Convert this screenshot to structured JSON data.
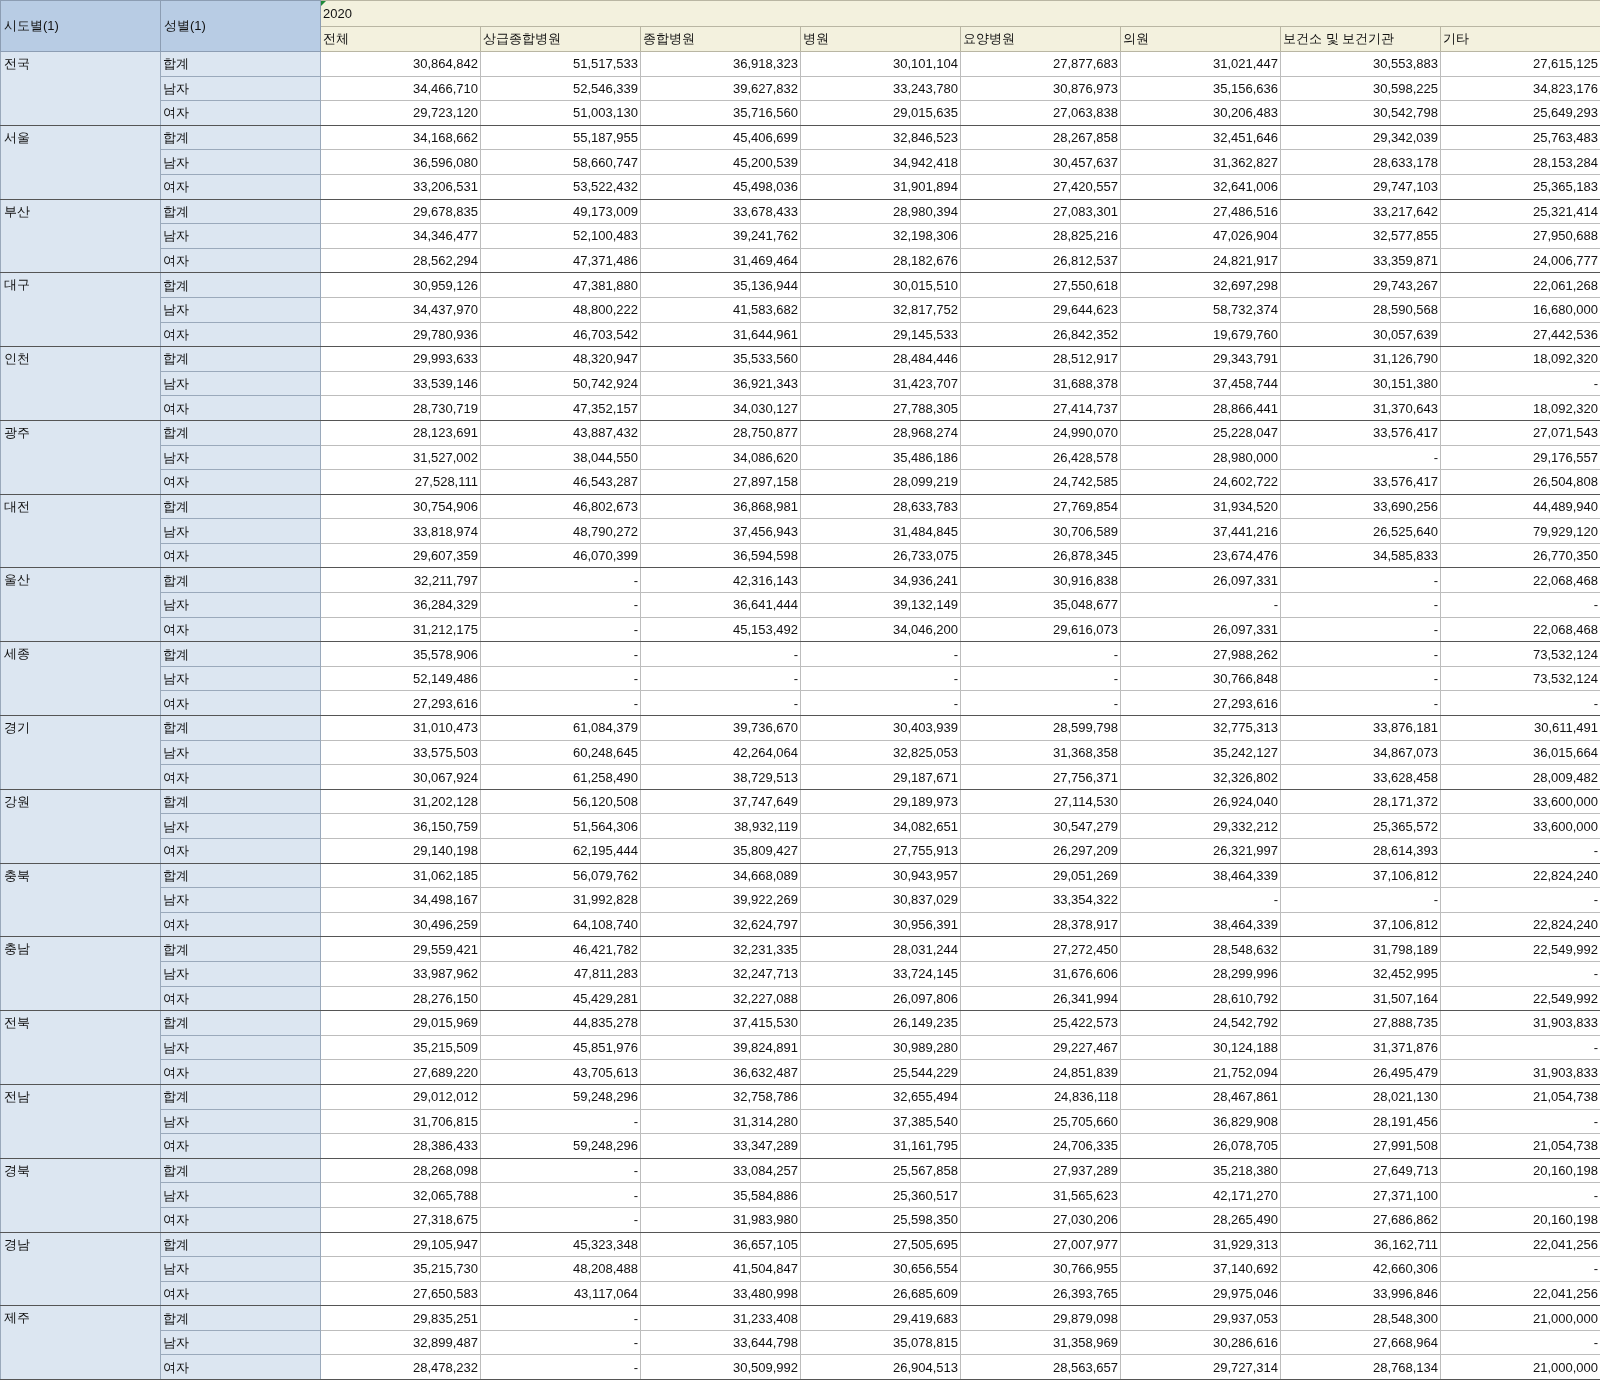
{
  "table": {
    "row_headers": [
      "시도별(1)",
      "성별(1)"
    ],
    "year": "2020",
    "columns": [
      "전체",
      "상급종합병원",
      "종합병원",
      "병원",
      "요양병원",
      "의원",
      "보건소 및 보건기관",
      "기타"
    ],
    "regions": [
      {
        "name": "전국",
        "rows": [
          {
            "sex": "합계",
            "values": [
              "30,864,842",
              "51,517,533",
              "36,918,323",
              "30,101,104",
              "27,877,683",
              "31,021,447",
              "30,553,883",
              "27,615,125"
            ]
          },
          {
            "sex": "남자",
            "values": [
              "34,466,710",
              "52,546,339",
              "39,627,832",
              "33,243,780",
              "30,876,973",
              "35,156,636",
              "30,598,225",
              "34,823,176"
            ]
          },
          {
            "sex": "여자",
            "values": [
              "29,723,120",
              "51,003,130",
              "35,716,560",
              "29,015,635",
              "27,063,838",
              "30,206,483",
              "30,542,798",
              "25,649,293"
            ]
          }
        ]
      },
      {
        "name": "서울",
        "rows": [
          {
            "sex": "합계",
            "values": [
              "34,168,662",
              "55,187,955",
              "45,406,699",
              "32,846,523",
              "28,267,858",
              "32,451,646",
              "29,342,039",
              "25,763,483"
            ]
          },
          {
            "sex": "남자",
            "values": [
              "36,596,080",
              "58,660,747",
              "45,200,539",
              "34,942,418",
              "30,457,637",
              "31,362,827",
              "28,633,178",
              "28,153,284"
            ]
          },
          {
            "sex": "여자",
            "values": [
              "33,206,531",
              "53,522,432",
              "45,498,036",
              "31,901,894",
              "27,420,557",
              "32,641,006",
              "29,747,103",
              "25,365,183"
            ]
          }
        ]
      },
      {
        "name": "부산",
        "rows": [
          {
            "sex": "합계",
            "values": [
              "29,678,835",
              "49,173,009",
              "33,678,433",
              "28,980,394",
              "27,083,301",
              "27,486,516",
              "33,217,642",
              "25,321,414"
            ]
          },
          {
            "sex": "남자",
            "values": [
              "34,346,477",
              "52,100,483",
              "39,241,762",
              "32,198,306",
              "28,825,216",
              "47,026,904",
              "32,577,855",
              "27,950,688"
            ]
          },
          {
            "sex": "여자",
            "values": [
              "28,562,294",
              "47,371,486",
              "31,469,464",
              "28,182,676",
              "26,812,537",
              "24,821,917",
              "33,359,871",
              "24,006,777"
            ]
          }
        ]
      },
      {
        "name": "대구",
        "rows": [
          {
            "sex": "합계",
            "values": [
              "30,959,126",
              "47,381,880",
              "35,136,944",
              "30,015,510",
              "27,550,618",
              "32,697,298",
              "29,743,267",
              "22,061,268"
            ]
          },
          {
            "sex": "남자",
            "values": [
              "34,437,970",
              "48,800,222",
              "41,583,682",
              "32,817,752",
              "29,644,623",
              "58,732,374",
              "28,590,568",
              "16,680,000"
            ]
          },
          {
            "sex": "여자",
            "values": [
              "29,780,936",
              "46,703,542",
              "31,644,961",
              "29,145,533",
              "26,842,352",
              "19,679,760",
              "30,057,639",
              "27,442,536"
            ]
          }
        ]
      },
      {
        "name": "인천",
        "rows": [
          {
            "sex": "합계",
            "values": [
              "29,993,633",
              "48,320,947",
              "35,533,560",
              "28,484,446",
              "28,512,917",
              "29,343,791",
              "31,126,790",
              "18,092,320"
            ]
          },
          {
            "sex": "남자",
            "values": [
              "33,539,146",
              "50,742,924",
              "36,921,343",
              "31,423,707",
              "31,688,378",
              "37,458,744",
              "30,151,380",
              "-"
            ]
          },
          {
            "sex": "여자",
            "values": [
              "28,730,719",
              "47,352,157",
              "34,030,127",
              "27,788,305",
              "27,414,737",
              "28,866,441",
              "31,370,643",
              "18,092,320"
            ]
          }
        ]
      },
      {
        "name": "광주",
        "rows": [
          {
            "sex": "합계",
            "values": [
              "28,123,691",
              "43,887,432",
              "28,750,877",
              "28,968,274",
              "24,990,070",
              "25,228,047",
              "33,576,417",
              "27,071,543"
            ]
          },
          {
            "sex": "남자",
            "values": [
              "31,527,002",
              "38,044,550",
              "34,086,620",
              "35,486,186",
              "26,428,578",
              "28,980,000",
              "-",
              "29,176,557"
            ]
          },
          {
            "sex": "여자",
            "values": [
              "27,528,111",
              "46,543,287",
              "27,897,158",
              "28,099,219",
              "24,742,585",
              "24,602,722",
              "33,576,417",
              "26,504,808"
            ]
          }
        ]
      },
      {
        "name": "대전",
        "rows": [
          {
            "sex": "합계",
            "values": [
              "30,754,906",
              "46,802,673",
              "36,868,981",
              "28,633,783",
              "27,769,854",
              "31,934,520",
              "33,690,256",
              "44,489,940"
            ]
          },
          {
            "sex": "남자",
            "values": [
              "33,818,974",
              "48,790,272",
              "37,456,943",
              "31,484,845",
              "30,706,589",
              "37,441,216",
              "26,525,640",
              "79,929,120"
            ]
          },
          {
            "sex": "여자",
            "values": [
              "29,607,359",
              "46,070,399",
              "36,594,598",
              "26,733,075",
              "26,878,345",
              "23,674,476",
              "34,585,833",
              "26,770,350"
            ]
          }
        ]
      },
      {
        "name": "울산",
        "rows": [
          {
            "sex": "합계",
            "values": [
              "32,211,797",
              "-",
              "42,316,143",
              "34,936,241",
              "30,916,838",
              "26,097,331",
              "-",
              "22,068,468"
            ]
          },
          {
            "sex": "남자",
            "values": [
              "36,284,329",
              "-",
              "36,641,444",
              "39,132,149",
              "35,048,677",
              "-",
              "-",
              "-"
            ]
          },
          {
            "sex": "여자",
            "values": [
              "31,212,175",
              "-",
              "45,153,492",
              "34,046,200",
              "29,616,073",
              "26,097,331",
              "-",
              "22,068,468"
            ]
          }
        ]
      },
      {
        "name": "세종",
        "rows": [
          {
            "sex": "합계",
            "values": [
              "35,578,906",
              "-",
              "-",
              "-",
              "-",
              "27,988,262",
              "-",
              "73,532,124"
            ]
          },
          {
            "sex": "남자",
            "values": [
              "52,149,486",
              "-",
              "-",
              "-",
              "-",
              "30,766,848",
              "-",
              "73,532,124"
            ]
          },
          {
            "sex": "여자",
            "values": [
              "27,293,616",
              "-",
              "-",
              "-",
              "-",
              "27,293,616",
              "-",
              "-"
            ]
          }
        ]
      },
      {
        "name": "경기",
        "rows": [
          {
            "sex": "합계",
            "values": [
              "31,010,473",
              "61,084,379",
              "39,736,670",
              "30,403,939",
              "28,599,798",
              "32,775,313",
              "33,876,181",
              "30,611,491"
            ]
          },
          {
            "sex": "남자",
            "values": [
              "33,575,503",
              "60,248,645",
              "42,264,064",
              "32,825,053",
              "31,368,358",
              "35,242,127",
              "34,867,073",
              "36,015,664"
            ]
          },
          {
            "sex": "여자",
            "values": [
              "30,067,924",
              "61,258,490",
              "38,729,513",
              "29,187,671",
              "27,756,371",
              "32,326,802",
              "33,628,458",
              "28,009,482"
            ]
          }
        ]
      },
      {
        "name": "강원",
        "rows": [
          {
            "sex": "합계",
            "values": [
              "31,202,128",
              "56,120,508",
              "37,747,649",
              "29,189,973",
              "27,114,530",
              "26,924,040",
              "28,171,372",
              "33,600,000"
            ]
          },
          {
            "sex": "남자",
            "values": [
              "36,150,759",
              "51,564,306",
              "38,932,119",
              "34,082,651",
              "30,547,279",
              "29,332,212",
              "25,365,572",
              "33,600,000"
            ]
          },
          {
            "sex": "여자",
            "values": [
              "29,140,198",
              "62,195,444",
              "35,809,427",
              "27,755,913",
              "26,297,209",
              "26,321,997",
              "28,614,393",
              "-"
            ]
          }
        ]
      },
      {
        "name": "충북",
        "rows": [
          {
            "sex": "합계",
            "values": [
              "31,062,185",
              "56,079,762",
              "34,668,089",
              "30,943,957",
              "29,051,269",
              "38,464,339",
              "37,106,812",
              "22,824,240"
            ]
          },
          {
            "sex": "남자",
            "values": [
              "34,498,167",
              "31,992,828",
              "39,922,269",
              "30,837,029",
              "33,354,322",
              "-",
              "-",
              "-"
            ]
          },
          {
            "sex": "여자",
            "values": [
              "30,496,259",
              "64,108,740",
              "32,624,797",
              "30,956,391",
              "28,378,917",
              "38,464,339",
              "37,106,812",
              "22,824,240"
            ]
          }
        ]
      },
      {
        "name": "충남",
        "rows": [
          {
            "sex": "합계",
            "values": [
              "29,559,421",
              "46,421,782",
              "32,231,335",
              "28,031,244",
              "27,272,450",
              "28,548,632",
              "31,798,189",
              "22,549,992"
            ]
          },
          {
            "sex": "남자",
            "values": [
              "33,987,962",
              "47,811,283",
              "32,247,713",
              "33,724,145",
              "31,676,606",
              "28,299,996",
              "32,452,995",
              "-"
            ]
          },
          {
            "sex": "여자",
            "values": [
              "28,276,150",
              "45,429,281",
              "32,227,088",
              "26,097,806",
              "26,341,994",
              "28,610,792",
              "31,507,164",
              "22,549,992"
            ]
          }
        ]
      },
      {
        "name": "전북",
        "rows": [
          {
            "sex": "합계",
            "values": [
              "29,015,969",
              "44,835,278",
              "37,415,530",
              "26,149,235",
              "25,422,573",
              "24,542,792",
              "27,888,735",
              "31,903,833"
            ]
          },
          {
            "sex": "남자",
            "values": [
              "35,215,509",
              "45,851,976",
              "39,824,891",
              "30,989,280",
              "29,227,467",
              "30,124,188",
              "31,371,876",
              "-"
            ]
          },
          {
            "sex": "여자",
            "values": [
              "27,689,220",
              "43,705,613",
              "36,632,487",
              "25,544,229",
              "24,851,839",
              "21,752,094",
              "26,495,479",
              "31,903,833"
            ]
          }
        ]
      },
      {
        "name": "전남",
        "rows": [
          {
            "sex": "합계",
            "values": [
              "29,012,012",
              "59,248,296",
              "32,758,786",
              "32,655,494",
              "24,836,118",
              "28,467,861",
              "28,021,130",
              "21,054,738"
            ]
          },
          {
            "sex": "남자",
            "values": [
              "31,706,815",
              "-",
              "31,314,280",
              "37,385,540",
              "25,705,660",
              "36,829,908",
              "28,191,456",
              "-"
            ]
          },
          {
            "sex": "여자",
            "values": [
              "28,386,433",
              "59,248,296",
              "33,347,289",
              "31,161,795",
              "24,706,335",
              "26,078,705",
              "27,991,508",
              "21,054,738"
            ]
          }
        ]
      },
      {
        "name": "경북",
        "rows": [
          {
            "sex": "합계",
            "values": [
              "28,268,098",
              "-",
              "33,084,257",
              "25,567,858",
              "27,937,289",
              "35,218,380",
              "27,649,713",
              "20,160,198"
            ]
          },
          {
            "sex": "남자",
            "values": [
              "32,065,788",
              "-",
              "35,584,886",
              "25,360,517",
              "31,565,623",
              "42,171,270",
              "27,371,100",
              "-"
            ]
          },
          {
            "sex": "여자",
            "values": [
              "27,318,675",
              "-",
              "31,983,980",
              "25,598,350",
              "27,030,206",
              "28,265,490",
              "27,686,862",
              "20,160,198"
            ]
          }
        ]
      },
      {
        "name": "경남",
        "rows": [
          {
            "sex": "합계",
            "values": [
              "29,105,947",
              "45,323,348",
              "36,657,105",
              "27,505,695",
              "27,007,977",
              "31,929,313",
              "36,162,711",
              "22,041,256"
            ]
          },
          {
            "sex": "남자",
            "values": [
              "35,215,730",
              "48,208,488",
              "41,504,847",
              "30,656,554",
              "30,766,955",
              "37,140,692",
              "42,660,306",
              "-"
            ]
          },
          {
            "sex": "여자",
            "values": [
              "27,650,583",
              "43,117,064",
              "33,480,998",
              "26,685,609",
              "26,393,765",
              "29,975,046",
              "33,996,846",
              "22,041,256"
            ]
          }
        ]
      },
      {
        "name": "제주",
        "rows": [
          {
            "sex": "합계",
            "values": [
              "29,835,251",
              "-",
              "31,233,408",
              "29,419,683",
              "29,879,098",
              "29,937,053",
              "28,548,300",
              "21,000,000"
            ]
          },
          {
            "sex": "남자",
            "values": [
              "32,899,487",
              "-",
              "33,644,798",
              "35,078,815",
              "31,358,969",
              "30,286,616",
              "27,668,964",
              "-"
            ]
          },
          {
            "sex": "여자",
            "values": [
              "28,478,232",
              "-",
              "30,509,992",
              "26,904,513",
              "28,563,657",
              "29,727,314",
              "28,768,134",
              "21,000,000"
            ]
          }
        ]
      }
    ]
  }
}
